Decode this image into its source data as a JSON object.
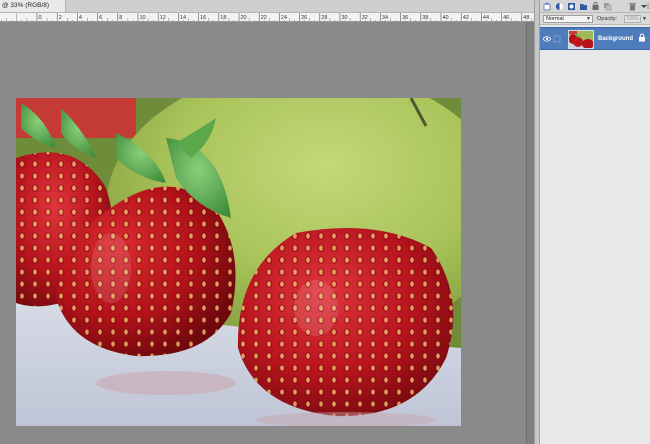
{
  "document": {
    "tab_title": "@ 33% (RGB/8)"
  },
  "ruler": {
    "ticks": [
      "0",
      "2",
      "4",
      "6",
      "8",
      "10",
      "12",
      "14",
      "16",
      "18",
      "20",
      "22",
      "24",
      "26",
      "28",
      "30",
      "32",
      "34",
      "36",
      "38",
      "40",
      "42",
      "44",
      "46",
      "48"
    ]
  },
  "layers_panel": {
    "blend_mode": "Normal",
    "opacity_label": "Opacity:",
    "opacity_value": "100%",
    "layers": [
      {
        "name": "Background",
        "selected": true,
        "visible": true,
        "locked": true
      }
    ],
    "toolbar_icons": [
      "new-layer-icon",
      "adjustment-layer-icon",
      "mask-icon",
      "group-icon",
      "link-icon",
      "merge-icon",
      "trash-icon",
      "panel-menu-icon"
    ]
  },
  "colors": {
    "selected_layer": "#4f7dbb",
    "canvas_bg": "#8a8a8a"
  }
}
